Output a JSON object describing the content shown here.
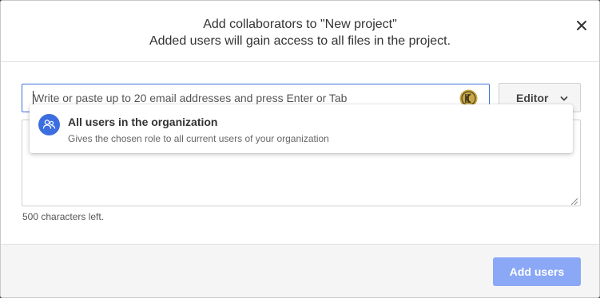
{
  "dialog": {
    "title": "Add collaborators to \"New project\"",
    "subtitle": "Added users will gain access to all files in the project.",
    "close_icon": "close-icon"
  },
  "email_input": {
    "placeholder": "Write or paste up to 20 email addresses and press Enter or Tab",
    "value": "",
    "trailing_icon": "keeper-icon"
  },
  "role_select": {
    "selected": "Editor",
    "icon": "chevron-down-icon"
  },
  "suggestion": {
    "icon": "users-group-icon",
    "title": "All users in the organization",
    "description": "Gives the chosen role to all current users of your organization"
  },
  "message": {
    "value": "",
    "chars_left": "500 characters left."
  },
  "footer": {
    "add_label": "Add users"
  },
  "colors": {
    "accent": "#3d6ee0",
    "button_disabled": "#8aa8f5",
    "keeper_gold": "#c9a844"
  }
}
